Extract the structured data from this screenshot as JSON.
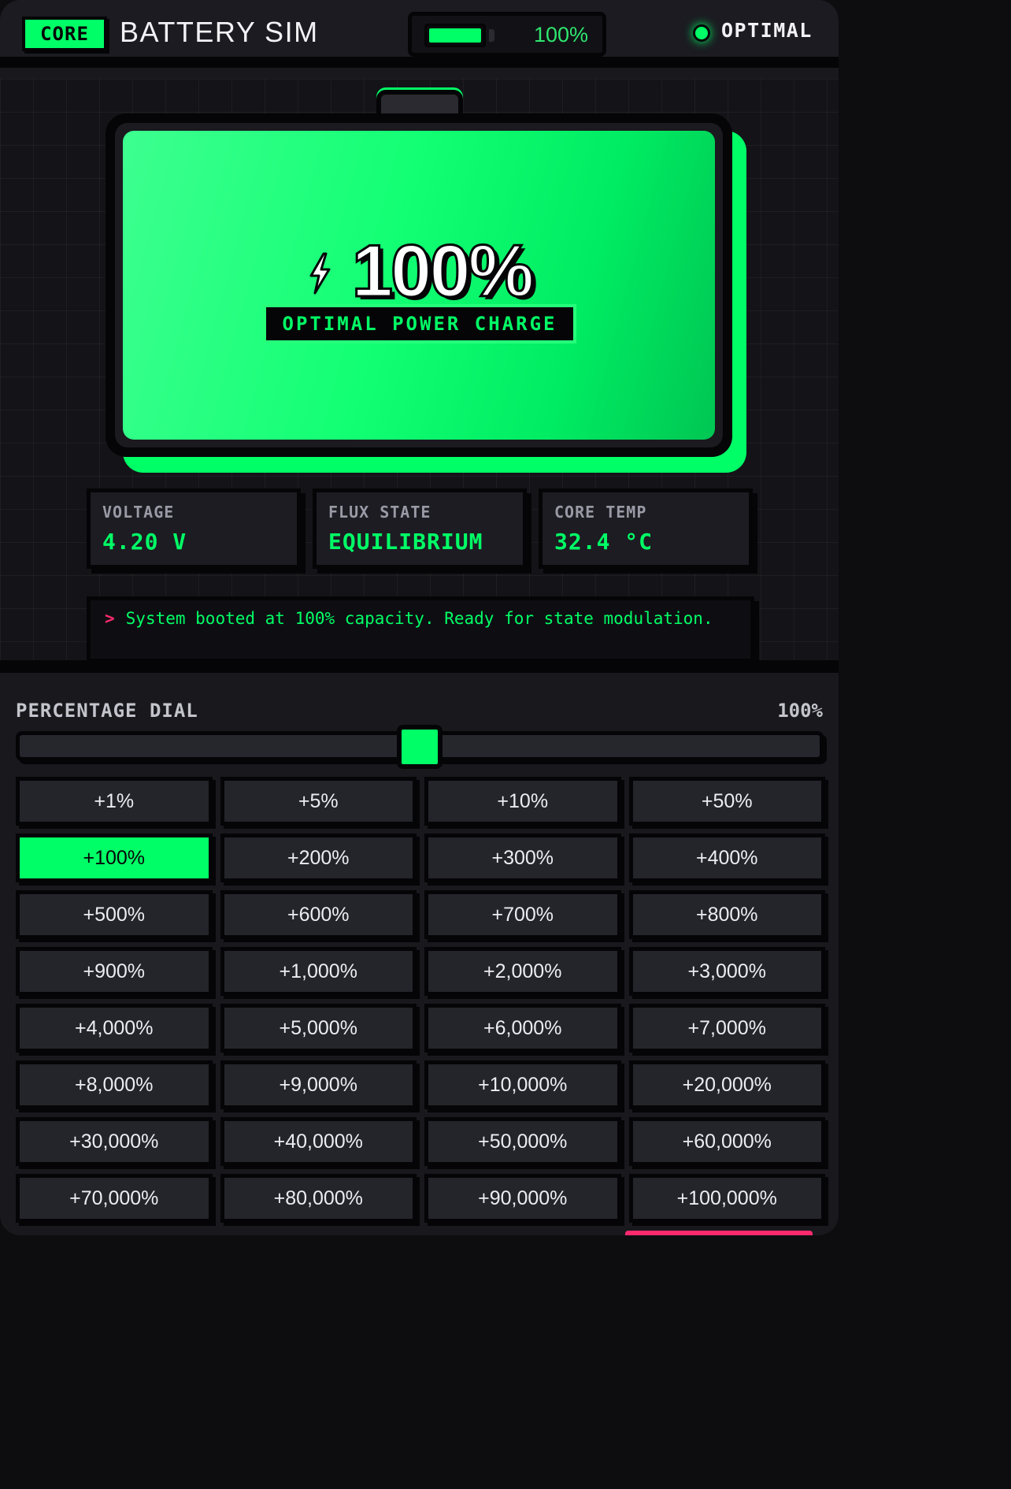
{
  "header": {
    "badge": "CORE",
    "title": "BATTERY SIM",
    "mini_percent": "100%",
    "mini_level": 1.0,
    "status": "OPTIMAL"
  },
  "battery": {
    "level": 1.0,
    "percent_text": "100%",
    "state_label": "OPTIMAL POWER CHARGE"
  },
  "stats": [
    {
      "label": "VOLTAGE",
      "value": "4.20 V"
    },
    {
      "label": "FLUX STATE",
      "value": "EQUILIBRIUM"
    },
    {
      "label": "CORE TEMP",
      "value": "32.4 °C"
    }
  ],
  "console": {
    "prompt": ">",
    "message": "System booted at 100% capacity. Ready for state modulation."
  },
  "dial": {
    "label": "PERCENTAGE DIAL",
    "value_text": "100%",
    "position": 0.5
  },
  "increments": [
    "+1%",
    "+5%",
    "+10%",
    "+50%",
    "+100%",
    "+200%",
    "+300%",
    "+400%",
    "+500%",
    "+600%",
    "+700%",
    "+800%",
    "+900%",
    "+1,000%",
    "+2,000%",
    "+3,000%",
    "+4,000%",
    "+5,000%",
    "+6,000%",
    "+7,000%",
    "+8,000%",
    "+9,000%",
    "+10,000%",
    "+20,000%",
    "+30,000%",
    "+40,000%",
    "+50,000%",
    "+60,000%",
    "+70,000%",
    "+80,000%",
    "+90,000%",
    "+100,000%"
  ],
  "active_increment": "+100%",
  "colors": {
    "accent": "#00ff66",
    "alert": "#ff2a6d",
    "panel": "#1c1c22",
    "outline": "#050507"
  }
}
